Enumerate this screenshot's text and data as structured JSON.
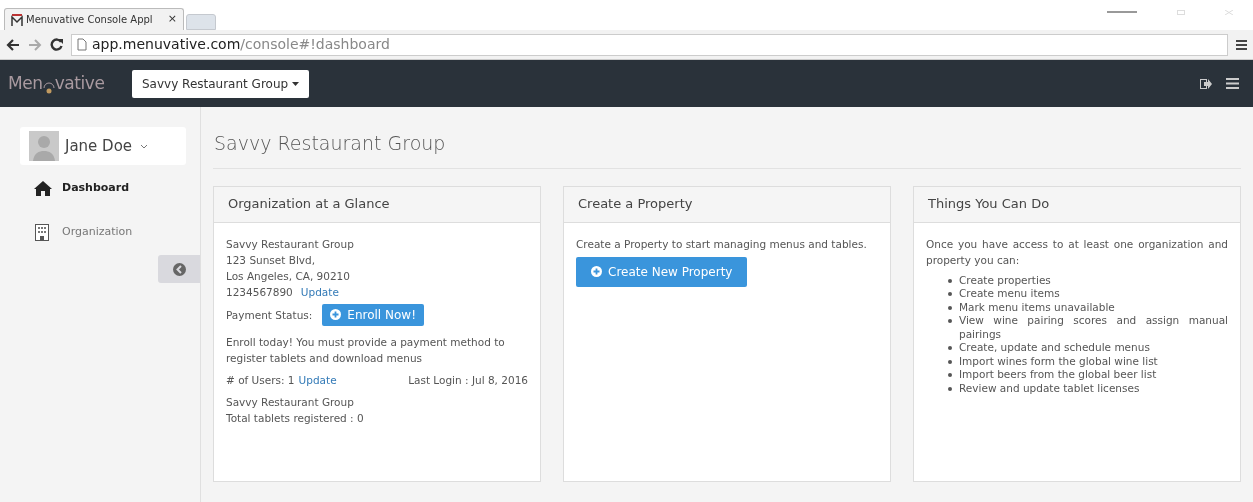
{
  "browser": {
    "tab": {
      "title": "Menuvative Console Appl",
      "close": "×"
    },
    "url_host": "app.menuvative.com",
    "url_path": "/console#!dashboard"
  },
  "navbar": {
    "logo_left": "Men",
    "logo_right": "vative",
    "org_dropdown": "Savvy Restaurant Group"
  },
  "sidebar": {
    "user": "Jane Doe",
    "items": [
      {
        "label": "Dashboard",
        "selected": true
      },
      {
        "label": "Organization",
        "selected": false
      }
    ]
  },
  "page_title": "Savvy Restaurant Group",
  "cards": [
    {
      "kind": "org",
      "title": "Organization at a Glance",
      "address": [
        "Savvy Restaurant Group",
        "123 Sunset Blvd,",
        "Los Angeles, CA, 90210"
      ],
      "phone": "1234567890",
      "phone_link": "Update",
      "payment_label": "Payment Status:",
      "payment_button": "Enroll Now!",
      "enroll_note": "Enroll today! You must provide a payment method to register tablets and download menus",
      "users": "# of Users: 1",
      "users_link": "Update",
      "last_login": "Last Login : Jul 8, 2016",
      "footer": [
        "Savvy Restaurant Group",
        "Total tablets registered : 0"
      ]
    },
    {
      "kind": "create",
      "title": "Create a Property",
      "text": "Create a Property to start managing menus and tables.",
      "button": "Create New Property"
    },
    {
      "kind": "todo",
      "title": "Things You Can Do",
      "intro": "Once you have access to at least one organization and property you can:",
      "items": [
        "Create properties",
        "Create menu items",
        "Mark menu items unavailable",
        "View wine pairing scores and assign manual pairings",
        "Create, update and schedule menus",
        "Import wines form the global wine list",
        "Import beers from the global beer list",
        "Review and update tablet licenses"
      ]
    }
  ]
}
